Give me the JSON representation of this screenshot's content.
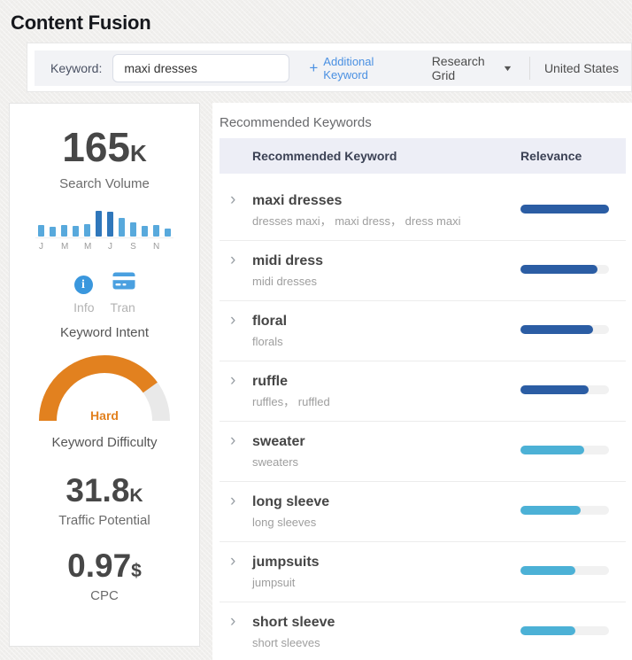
{
  "page": {
    "title": "Content Fusion"
  },
  "icons": {
    "chevron_right": "›",
    "caret_down": "▼",
    "info_glyph": "i"
  },
  "header": {
    "keyword_label": "Keyword:",
    "keyword_value": "maxi dresses",
    "additional_keyword": {
      "plus": "+",
      "label": "Additional Keyword"
    },
    "research_grid_label": "Research Grid",
    "country": "United States"
  },
  "sidebar": {
    "search_volume": {
      "value": "165",
      "unit": "K",
      "label": "Search Volume"
    },
    "volume_chart": {
      "type": "bar",
      "months": [
        "J",
        "",
        "M",
        "",
        "M",
        "",
        "J",
        "",
        "S",
        "",
        "N",
        ""
      ],
      "values": [
        44,
        38,
        44,
        40,
        50,
        100,
        97,
        72,
        54,
        40,
        46,
        32
      ],
      "peak_indexes": [
        5,
        6
      ],
      "bar_color": "#58a9dc",
      "peak_color": "#2f77bb"
    },
    "keyword_intent": {
      "label": "Keyword Intent",
      "intents": [
        {
          "icon": "info-icon",
          "label": "Info"
        },
        {
          "icon": "transaction-card-icon",
          "label": "Tran"
        }
      ]
    },
    "keyword_difficulty": {
      "label": "Keyword Difficulty",
      "level": "Hard",
      "percent": 80,
      "arc_color": "#e2811f",
      "track_color": "#e9e9e9"
    },
    "traffic_potential": {
      "value": "31.8",
      "unit": "K",
      "label": "Traffic Potential"
    },
    "cpc": {
      "value": "0.97",
      "unit": "$",
      "label": "CPC"
    }
  },
  "recommended": {
    "section_title": "Recommended Keywords",
    "columns": {
      "keyword": "Recommended Keyword",
      "relevance": "Relevance"
    },
    "relevance_colors": {
      "high": "#2b5da4",
      "medium": "#4cb1d6",
      "track": "#f1f1f1"
    },
    "rows": [
      {
        "keyword": "maxi dresses",
        "variants": "dresses maxi， maxi dress， dress maxi",
        "relevance_pct": 100,
        "tier": "high"
      },
      {
        "keyword": "midi dress",
        "variants": "midi dresses",
        "relevance_pct": 87,
        "tier": "high"
      },
      {
        "keyword": "floral",
        "variants": "florals",
        "relevance_pct": 82,
        "tier": "high"
      },
      {
        "keyword": "ruffle",
        "variants": "ruffles， ruffled",
        "relevance_pct": 77,
        "tier": "high"
      },
      {
        "keyword": "sweater",
        "variants": "sweaters",
        "relevance_pct": 72,
        "tier": "medium"
      },
      {
        "keyword": "long sleeve",
        "variants": "long sleeves",
        "relevance_pct": 68,
        "tier": "medium"
      },
      {
        "keyword": "jumpsuits",
        "variants": "jumpsuit",
        "relevance_pct": 62,
        "tier": "medium"
      },
      {
        "keyword": "short sleeve",
        "variants": "short sleeves",
        "relevance_pct": 62,
        "tier": "medium"
      }
    ]
  }
}
